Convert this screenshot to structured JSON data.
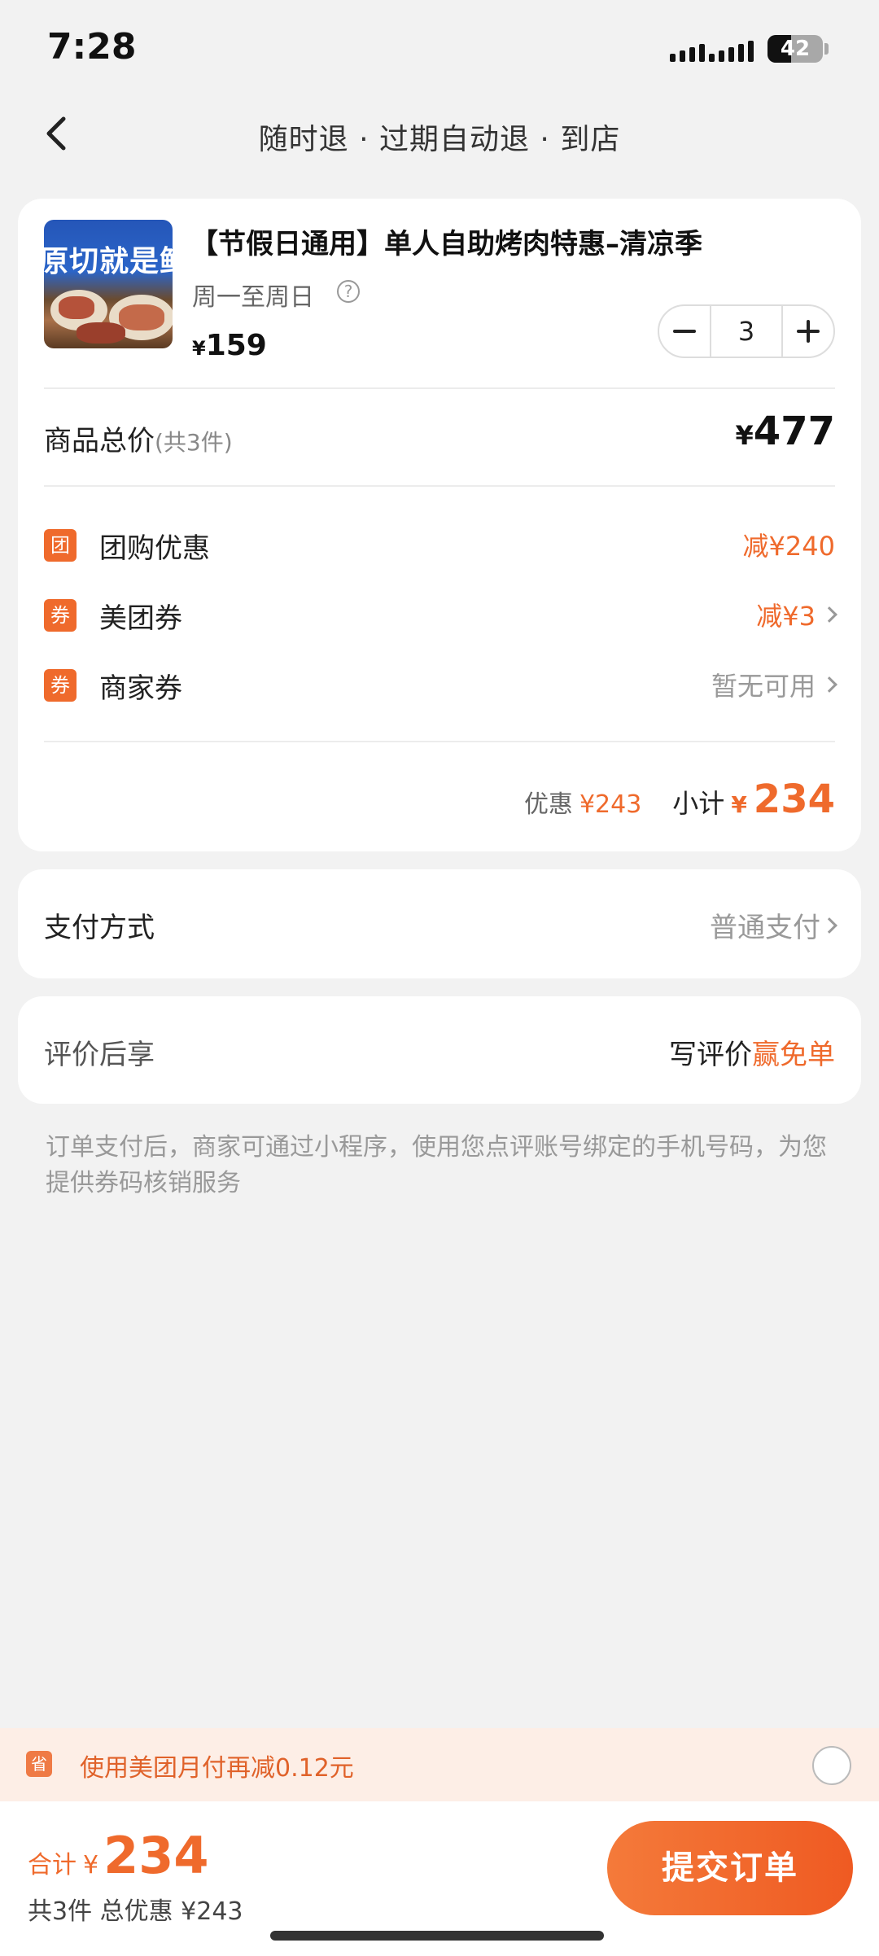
{
  "status": {
    "time": "7:28",
    "battery": "42"
  },
  "nav": {
    "title": "随时退 · 过期自动退 · 到店"
  },
  "product": {
    "image_text": "原切就是鲜",
    "title": "【节假日通用】单人自助烤肉特惠–清凉季",
    "availability": "周一至周日",
    "price_yen": "¥",
    "price": "159",
    "quantity": "3"
  },
  "totals": {
    "label": "商品总价",
    "count_note": "(共3件)",
    "amount_yen": "¥",
    "amount": "477"
  },
  "discounts": [
    {
      "tag": "团",
      "label": "团购优惠",
      "value": "减¥240"
    },
    {
      "tag": "券",
      "label": "美团券",
      "value": "减¥3"
    },
    {
      "tag": "券",
      "label": "商家券",
      "value": "暂无可用"
    }
  ],
  "summary": {
    "discount_label": "优惠",
    "discount_value": "¥243",
    "subtotal_label": "小计",
    "subtotal_yen": "¥",
    "subtotal_value": "234"
  },
  "payment": {
    "label": "支付方式",
    "value": "普通支付"
  },
  "review": {
    "label": "评价后享",
    "value_prefix": "写评价",
    "value_highlight": "赢免单"
  },
  "note": "订单支付后，商家可通过小程序，使用您点评账号绑定的手机号码，为您提供券码核销服务",
  "promo": {
    "icon_text": "省",
    "text": "使用美团月付再减0.12元"
  },
  "checkout": {
    "total_label": "合计",
    "total_yen": "¥",
    "total_value": "234",
    "summary_line": "共3件  总优惠 ¥243",
    "submit_label": "提交订单"
  },
  "colors": {
    "accent": "#ef6a2c",
    "background": "#f2f2f2"
  }
}
